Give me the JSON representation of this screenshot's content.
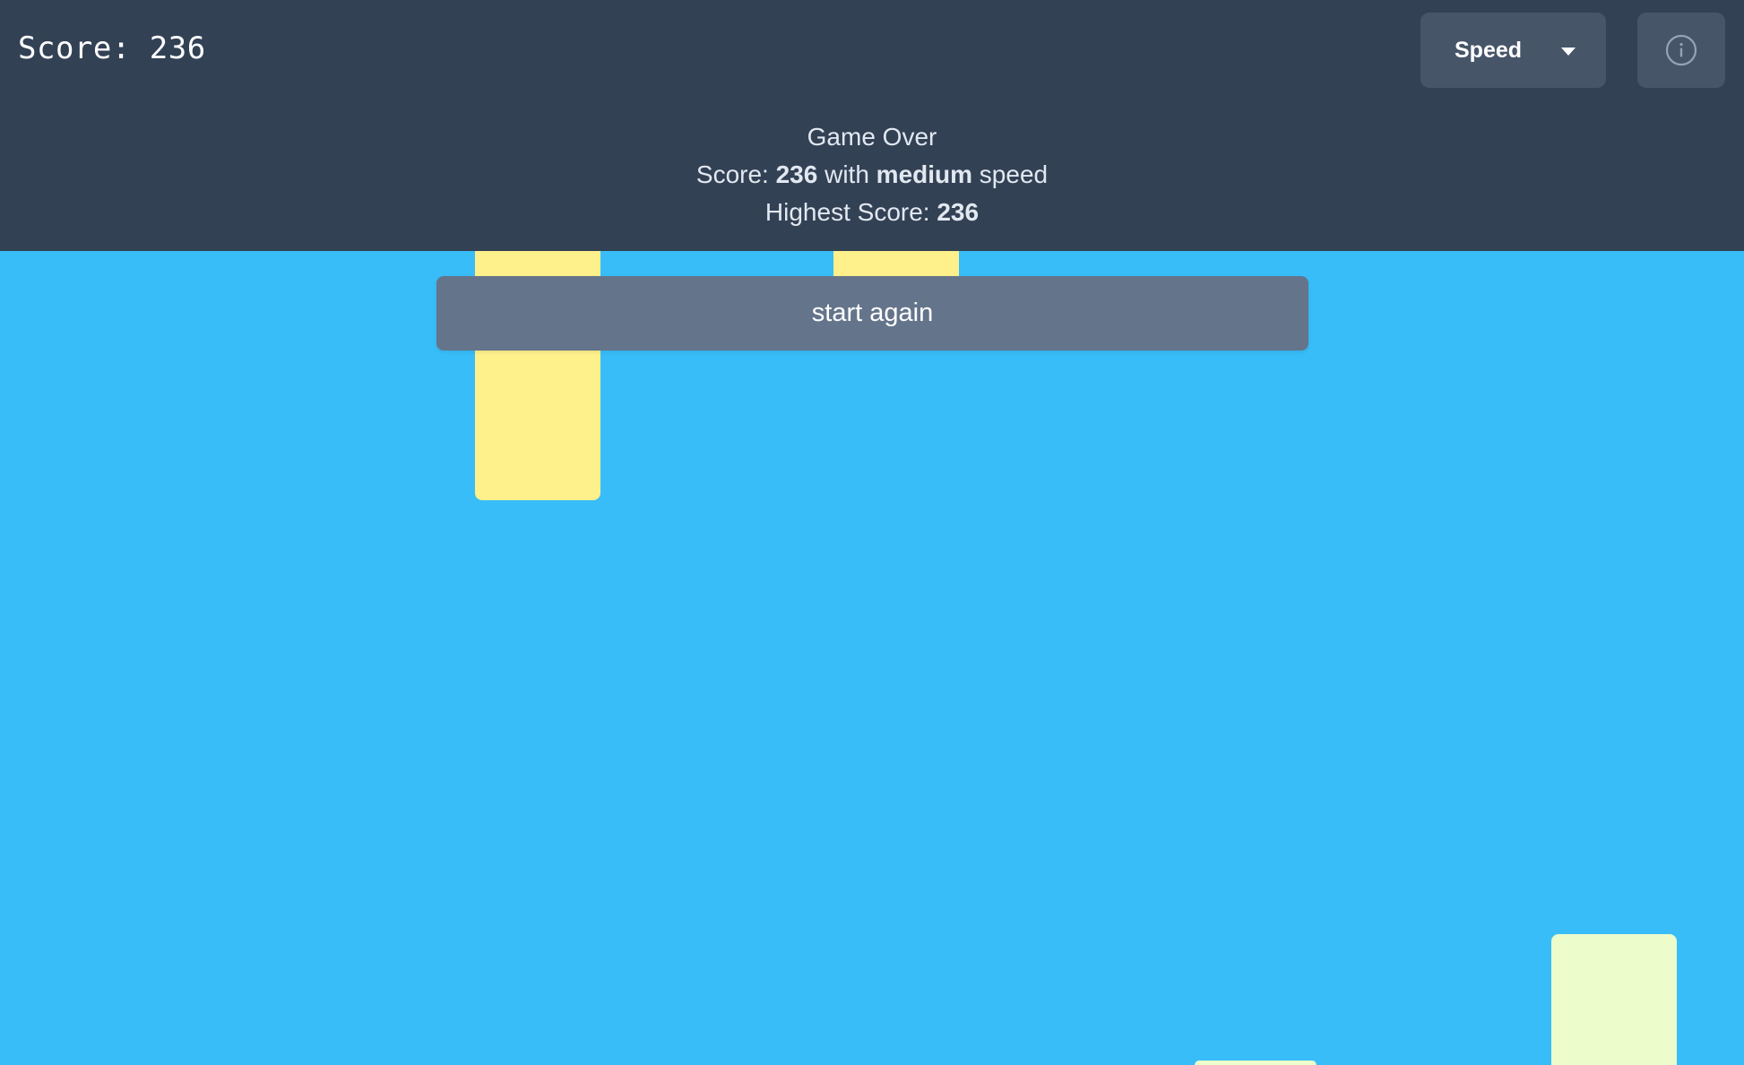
{
  "hud": {
    "score_text": "Score: 236"
  },
  "controls": {
    "speed_label": "Speed",
    "info_icon": "info-circle-icon",
    "dropdown_icon": "caret-down-icon"
  },
  "game_over": {
    "title": "Game Over",
    "score_prefix": "Score: ",
    "score_value": "236",
    "score_mid": " with ",
    "speed_value": "medium",
    "score_suffix": " speed",
    "highest_prefix": "Highest Score: ",
    "highest_value": "236"
  },
  "start_again_label": "start again",
  "colors": {
    "sky": "#38bdf8",
    "panel": "#334155",
    "button": "#475569",
    "start_button": "#64748b",
    "pipe_yellow": "#fef08a",
    "pipe_green": "#ecfccb"
  }
}
